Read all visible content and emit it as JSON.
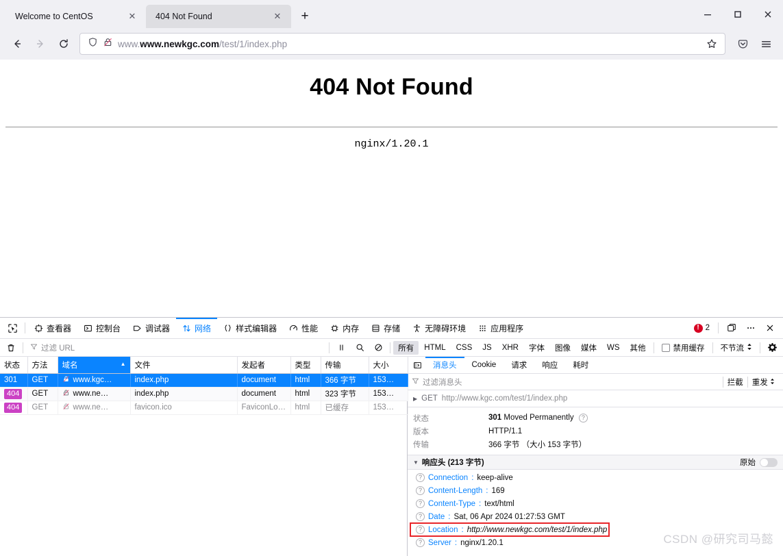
{
  "browser": {
    "tabs": [
      {
        "title": "Welcome to CentOS",
        "active": false
      },
      {
        "title": "404 Not Found",
        "active": true
      }
    ],
    "new_tab_label": "+",
    "close_label": "✕",
    "window_controls": {
      "minimize": "—",
      "maximize": "☐",
      "close": "✕"
    },
    "nav": {
      "back": "←",
      "forward": "→",
      "reload": "⟳"
    },
    "url": {
      "domain": "www.newkgc.com",
      "path": "/test/1/index.php"
    },
    "accent": "#0a84ff"
  },
  "page": {
    "heading": "404 Not Found",
    "server": "nginx/1.20.1"
  },
  "devtools": {
    "tabs": [
      {
        "label": "查看器",
        "icon": "inspector-icon",
        "active": false
      },
      {
        "label": "控制台",
        "icon": "console-icon",
        "active": false
      },
      {
        "label": "调试器",
        "icon": "debugger-icon",
        "active": false
      },
      {
        "label": "网络",
        "icon": "network-icon",
        "active": true
      },
      {
        "label": "样式编辑器",
        "icon": "style-editor-icon",
        "active": false
      },
      {
        "label": "性能",
        "icon": "performance-icon",
        "active": false
      },
      {
        "label": "内存",
        "icon": "memory-icon",
        "active": false
      },
      {
        "label": "存储",
        "icon": "storage-icon",
        "active": false
      },
      {
        "label": "无障碍环境",
        "icon": "accessibility-icon",
        "active": false
      },
      {
        "label": "应用程序",
        "icon": "application-icon",
        "active": false
      }
    ],
    "error_count": "2",
    "filter_placeholder": "过滤 URL",
    "type_filters": [
      {
        "label": "所有",
        "active": true
      },
      {
        "label": "HTML",
        "active": false
      },
      {
        "label": "CSS",
        "active": false
      },
      {
        "label": "JS",
        "active": false
      },
      {
        "label": "XHR",
        "active": false
      },
      {
        "label": "字体",
        "active": false
      },
      {
        "label": "图像",
        "active": false
      },
      {
        "label": "媒体",
        "active": false
      },
      {
        "label": "WS",
        "active": false
      },
      {
        "label": "其他",
        "active": false
      }
    ],
    "disable_cache_label": "禁用缓存",
    "throttle_label": "不节流"
  },
  "netgrid": {
    "columns": [
      {
        "label": "状态",
        "sorted": false
      },
      {
        "label": "方法",
        "sorted": false
      },
      {
        "label": "域名",
        "sorted": true
      },
      {
        "label": "文件",
        "sorted": false
      },
      {
        "label": "发起者",
        "sorted": false
      },
      {
        "label": "类型",
        "sorted": false
      },
      {
        "label": "传输",
        "sorted": false
      },
      {
        "label": "大小",
        "sorted": false
      }
    ],
    "sort_arrow": "▲",
    "rows": [
      {
        "status": "301",
        "method": "GET",
        "domain": "www.kgc…",
        "file": "index.php",
        "initiator": "document",
        "type": "html",
        "transfer": "366 字节",
        "size": "153…",
        "selected": true,
        "badge": false,
        "dim": false,
        "initiator_link": false
      },
      {
        "status": "404",
        "method": "GET",
        "domain": "www.ne…",
        "file": "index.php",
        "initiator": "document",
        "type": "html",
        "transfer": "323 字节",
        "size": "153…",
        "selected": false,
        "badge": true,
        "dim": false,
        "initiator_link": false
      },
      {
        "status": "404",
        "method": "GET",
        "domain": "www.ne…",
        "file": "favicon.ico",
        "initiator": "FaviconLoad…",
        "type": "html",
        "transfer": "已缓存",
        "size": "153…",
        "selected": false,
        "badge": true,
        "dim": true,
        "initiator_link": true
      }
    ]
  },
  "detail": {
    "tabs": [
      {
        "label": "消息头",
        "active": true
      },
      {
        "label": "Cookie",
        "active": false
      },
      {
        "label": "请求",
        "active": false
      },
      {
        "label": "响应",
        "active": false
      },
      {
        "label": "耗时",
        "active": false
      }
    ],
    "header_filter_placeholder": "过滤消息头",
    "block_label": "拦截",
    "resend_label": "重发",
    "request_method": "GET",
    "request_url": "http://www.kgc.com/test/1/index.php",
    "summary": [
      {
        "key": "状态",
        "value": "301",
        "extra": "Moved Permanently",
        "help": true
      },
      {
        "key": "版本",
        "value": "HTTP/1.1",
        "extra": "",
        "help": false
      },
      {
        "key": "传输",
        "value": "366 字节",
        "extra": "（大小 153 字节）",
        "help": false
      }
    ],
    "response_section_title": "响应头 (213 字节)",
    "raw_label": "原始",
    "response_headers": [
      {
        "name": "Connection",
        "value": "keep-alive",
        "italic": false,
        "highlight": false
      },
      {
        "name": "Content-Length",
        "value": "169",
        "italic": false,
        "highlight": false
      },
      {
        "name": "Content-Type",
        "value": "text/html",
        "italic": false,
        "highlight": false
      },
      {
        "name": "Date",
        "value": "Sat, 06 Apr 2024 01:27:53 GMT",
        "italic": false,
        "highlight": false
      },
      {
        "name": "Location",
        "value": "http://www.newkgc.com/test/1/index.php",
        "italic": true,
        "highlight": true
      },
      {
        "name": "Server",
        "value": "nginx/1.20.1",
        "italic": false,
        "highlight": false
      }
    ]
  },
  "watermark": "CSDN @研究司马懿"
}
